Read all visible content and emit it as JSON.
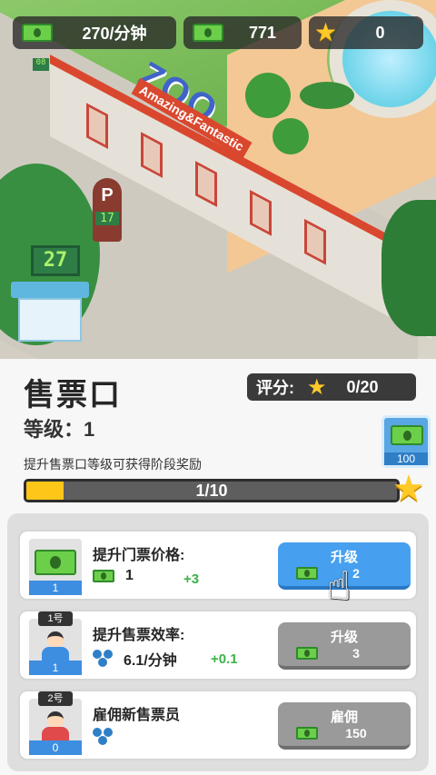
{
  "top_bar": {
    "income_rate": "270/分钟",
    "cash": "771",
    "stars": "0",
    "icons": {
      "income": "cash-icon",
      "cash": "cash-icon",
      "stars": "star-icon"
    }
  },
  "scene": {
    "zoo_sign": "ZOO",
    "zoo_subtitle": "Amazing&Fantastic",
    "booth_counter": "27",
    "parking_letter": "P",
    "parking_counter": "17",
    "small_counter": "08"
  },
  "panel": {
    "title": "售票口",
    "level_label": "等级：1",
    "rating_label": "评分:",
    "rating_value": "0/20",
    "hint": "提升售票口等级可获得阶段奖励",
    "reward_amount": "100",
    "progress_text": "1/10",
    "progress_fraction": 0.1
  },
  "upgrades": [
    {
      "name": "提升门票价格:",
      "thumb_badge": "1",
      "value": "1",
      "delta": "+3",
      "button_label": "升级",
      "cost": "2",
      "button_state": "active"
    },
    {
      "name": "提升售票效率:",
      "thumb_tag": "1号",
      "thumb_badge": "1",
      "value": "6.1/分钟",
      "delta": "+0.1",
      "button_label": "升级",
      "cost": "3",
      "button_state": "disabled"
    },
    {
      "name": "雇佣新售票员",
      "thumb_tag": "2号",
      "thumb_badge": "0",
      "button_label": "雇佣",
      "cost": "150",
      "button_state": "disabled"
    }
  ],
  "colors": {
    "accent_blue": "#46a0ef",
    "progress_yellow": "#ffc61a",
    "delta_green": "#3bb24a",
    "disabled_gray": "#9a9a9a"
  }
}
